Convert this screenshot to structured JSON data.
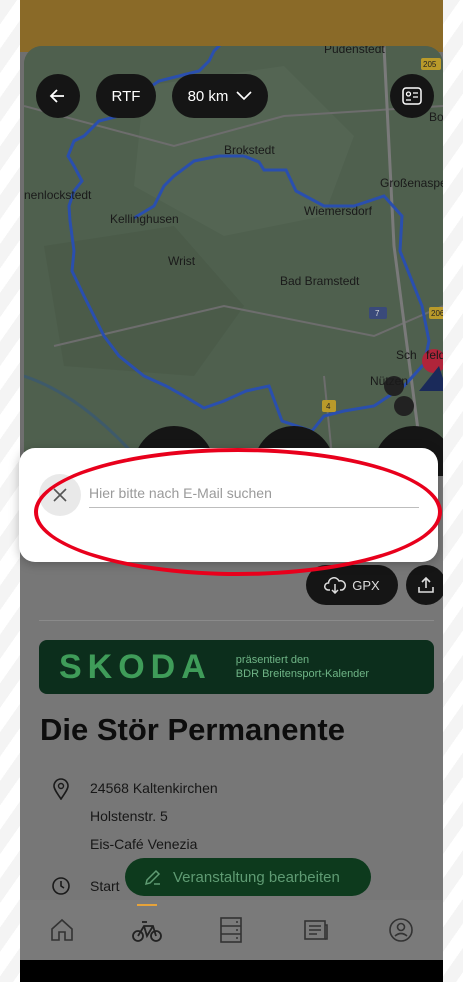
{
  "map": {
    "labels": [
      "Brokstedt",
      "Großenaspe",
      "nenlockstedt",
      "Wiemersdorf",
      "Kellinghusen",
      "Wrist",
      "Bad Bramstedt",
      "Nützen",
      "Sch",
      "feld",
      "Pudenstedt",
      "Bo"
    ],
    "road_badges": [
      "205",
      "206",
      "7",
      "4"
    ],
    "back_icon": "arrow-left-icon",
    "type_label": "RTF",
    "distance_label": "80 km",
    "contact_icon": "contact-card-icon"
  },
  "dialog": {
    "placeholder": "Hier bitte nach E-Mail suchen",
    "close_icon": "close-icon"
  },
  "actions": {
    "gpx_label": "GPX",
    "gpx_icon": "cloud-download-icon",
    "share_icon": "share-icon"
  },
  "banner": {
    "brand": "SKODA",
    "line1": "präsentiert den",
    "line2": "BDR Breitensport-Kalender"
  },
  "event": {
    "title": "Die Stör Permanente",
    "address_line1": "24568 Kaltenkirchen",
    "address_line2": "Holstenstr. 5",
    "address_line3": "Eis-Café Venezia",
    "start_label": "Start"
  },
  "fab": {
    "label": "Veranstaltung bearbeiten",
    "icon": "edit-icon"
  },
  "navbar": {
    "items": [
      "home-icon",
      "bike-icon",
      "list-icon",
      "news-icon",
      "profile-icon"
    ],
    "active": "bike-icon"
  },
  "colors": {
    "route": "#2a4fae",
    "highlight_ellipse": "#e8001c",
    "banner_bg": "#0c2e1c",
    "brand_green": "#3f9c59",
    "active_tab": "#e6a33a"
  }
}
